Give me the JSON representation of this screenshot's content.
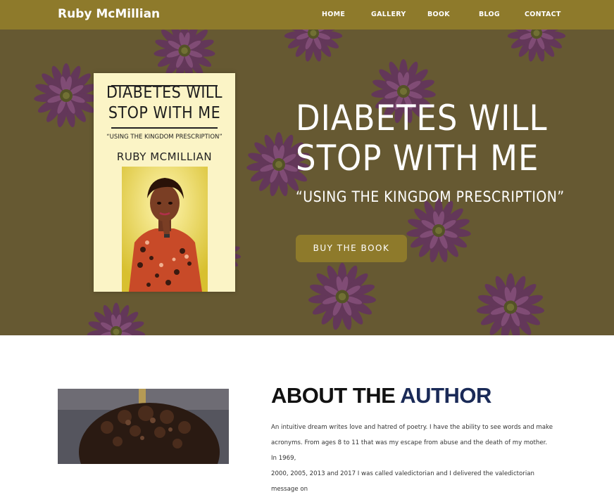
{
  "header": {
    "brand": "Ruby McMillian",
    "nav": [
      "HOME",
      "GALLERY",
      "BOOK",
      "BLOG",
      "CONTACT"
    ],
    "bg_color": "#8e7a2b"
  },
  "hero": {
    "title_line1": "DIABETES WILL",
    "title_line2": "STOP WITH ME",
    "subtitle": "“USING THE KINGDOM PRESCRIPTION”",
    "button_label": "BUY THE BOOK",
    "bg_color": "#6f6137",
    "cover": {
      "title_line1": "DIABETES WILL",
      "title_line2": "STOP WITH ME",
      "tagline": "“USING THE KINGDOM PRESCRIPTION”",
      "author": "RUBY MCMILLIAN",
      "bg_color": "#fbf4c6"
    }
  },
  "about": {
    "heading_part1": "ABOUT THE ",
    "heading_part2": "AUTHOR",
    "accent_color": "#1a2a57",
    "paragraph_lines": [
      "An intuitive dream writes love and hatred of poetry. I have the ability to see words and make",
      "acronyms. From ages 8 to 11 that was my escape from abuse and the death of my mother. In 1969,",
      "2000, 2005, 2013 and 2017 I was called valedictorian and I delivered the valedictorian message on"
    ]
  }
}
